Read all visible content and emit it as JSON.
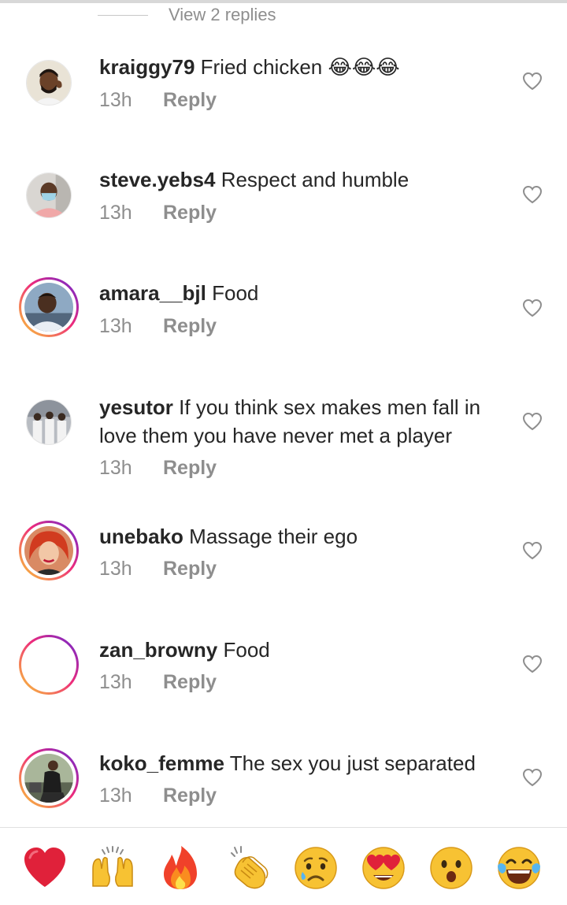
{
  "thread": {
    "view_replies_label": "View 2 replies"
  },
  "comments": [
    {
      "username": "kraiggy79",
      "text": "Fried chicken 😂😂😂",
      "time": "13h",
      "reply_label": "Reply"
    },
    {
      "username": "steve.yebs4",
      "text": "Respect and humble",
      "time": "13h",
      "reply_label": "Reply"
    },
    {
      "username": "amara__bjl",
      "text": "Food",
      "time": "13h",
      "reply_label": "Reply"
    },
    {
      "username": "yesutor",
      "text": "If you think sex makes men fall in love them you have never met a player",
      "time": "13h",
      "reply_label": "Reply"
    },
    {
      "username": "unebako",
      "text": "Massage their ego",
      "time": "13h",
      "reply_label": "Reply"
    },
    {
      "username": "zan_browny",
      "text": "Food",
      "time": "13h",
      "reply_label": "Reply"
    },
    {
      "username": "koko_femme",
      "text": "The sex you just separated",
      "time": "13h",
      "reply_label": "Reply"
    }
  ],
  "emoji_bar": [
    {
      "name": "red-heart",
      "emoji": "❤️"
    },
    {
      "name": "raising-hands",
      "emoji": "🙌"
    },
    {
      "name": "fire",
      "emoji": "🔥"
    },
    {
      "name": "clapping-hands",
      "emoji": "👏"
    },
    {
      "name": "sad-face",
      "emoji": "😢"
    },
    {
      "name": "heart-eyes",
      "emoji": "😍"
    },
    {
      "name": "surprised-face",
      "emoji": "😮"
    },
    {
      "name": "tears-of-joy",
      "emoji": "😂"
    }
  ],
  "colors": {
    "text": "#262626",
    "secondary_text": "#8e8e8e",
    "story_ring": "#ee2a7b",
    "background": "#ffffff"
  }
}
